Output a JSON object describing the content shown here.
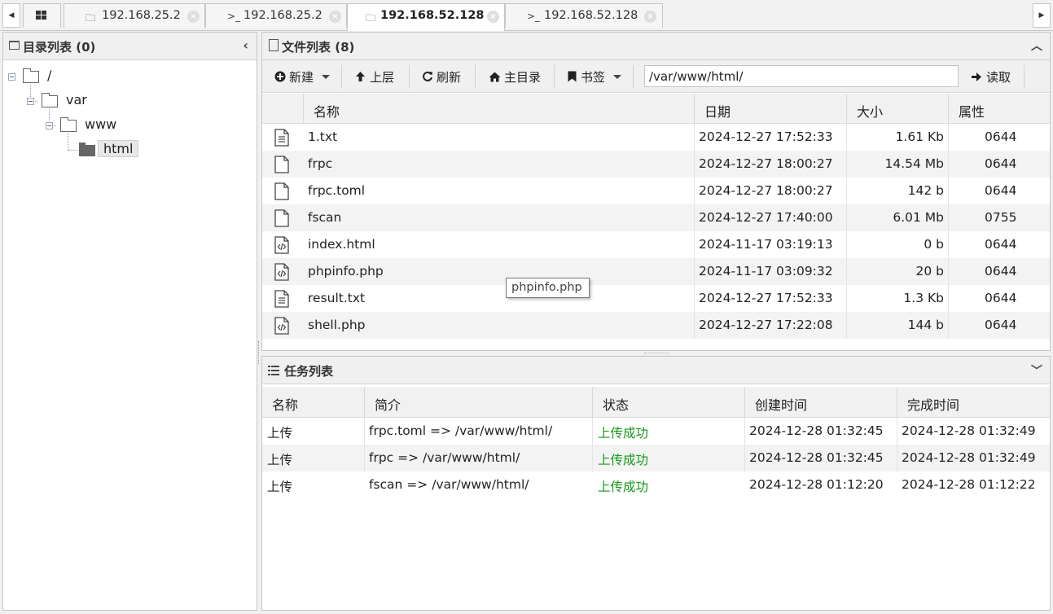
{
  "tabs": [
    {
      "icon": "folder-icon",
      "label": "192.168.25.2",
      "active": false
    },
    {
      "icon": "terminal-icon",
      "label": "192.168.25.2",
      "active": false
    },
    {
      "icon": "folder-icon",
      "label": "192.168.52.128",
      "active": true
    },
    {
      "icon": "terminal-icon",
      "label": "192.168.52.128",
      "active": false
    }
  ],
  "tab_icons": {
    "folder": "🗀",
    "terminal": ">_"
  },
  "dir_panel": {
    "title": "目录列表 (0)"
  },
  "tree": [
    {
      "label": "/",
      "level": 0
    },
    {
      "label": "var",
      "level": 1
    },
    {
      "label": "www",
      "level": 2
    },
    {
      "label": "html",
      "level": 3,
      "selected": true
    }
  ],
  "file_panel": {
    "title": "文件列表 (8)"
  },
  "toolbar": {
    "new_label": "新建",
    "up_label": "上层",
    "refresh_label": "刷新",
    "home_label": "主目录",
    "bookmark_label": "书签",
    "path_value": "/var/www/html/",
    "read_label": "读取"
  },
  "file_columns": {
    "name": "名称",
    "date": "日期",
    "size": "大小",
    "attr": "属性"
  },
  "files": [
    {
      "name": "1.txt",
      "date": "2024-12-27 17:52:33",
      "size": "1.61 Kb",
      "attr": "0644",
      "icon": "text-file-icon"
    },
    {
      "name": "frpc",
      "date": "2024-12-27 18:00:27",
      "size": "14.54 Mb",
      "attr": "0644",
      "icon": "file-icon"
    },
    {
      "name": "frpc.toml",
      "date": "2024-12-27 18:00:27",
      "size": "142 b",
      "attr": "0644",
      "icon": "file-icon"
    },
    {
      "name": "fscan",
      "date": "2024-12-27 17:40:00",
      "size": "6.01 Mb",
      "attr": "0755",
      "icon": "file-icon"
    },
    {
      "name": "index.html",
      "date": "2024-11-17 03:19:13",
      "size": "0 b",
      "attr": "0644",
      "icon": "code-file-icon"
    },
    {
      "name": "phpinfo.php",
      "date": "2024-11-17 03:09:32",
      "size": "20 b",
      "attr": "0644",
      "icon": "code-file-icon"
    },
    {
      "name": "result.txt",
      "date": "2024-12-27 17:52:33",
      "size": "1.3 Kb",
      "attr": "0644",
      "icon": "text-file-icon"
    },
    {
      "name": "shell.php",
      "date": "2024-12-27 17:22:08",
      "size": "144 b",
      "attr": "0644",
      "icon": "code-file-icon"
    }
  ],
  "tooltip": "phpinfo.php",
  "task_panel": {
    "title": "任务列表"
  },
  "task_columns": {
    "name": "名称",
    "desc": "简介",
    "status": "状态",
    "created": "创建时间",
    "finished": "完成时间"
  },
  "tasks": [
    {
      "name": "上传",
      "desc": "frpc.toml => /var/www/html/",
      "status": "上传成功",
      "created": "2024-12-28 01:32:45",
      "finished": "2024-12-28 01:32:49"
    },
    {
      "name": "上传",
      "desc": "frpc => /var/www/html/",
      "status": "上传成功",
      "created": "2024-12-28 01:32:45",
      "finished": "2024-12-28 01:32:49"
    },
    {
      "name": "上传",
      "desc": "fscan => /var/www/html/",
      "status": "上传成功",
      "created": "2024-12-28 01:12:20",
      "finished": "2024-12-28 01:12:22"
    }
  ],
  "colors": {
    "success": "#159a18",
    "panel_header": "#f0f0f0",
    "border": "#c6c6c6"
  }
}
